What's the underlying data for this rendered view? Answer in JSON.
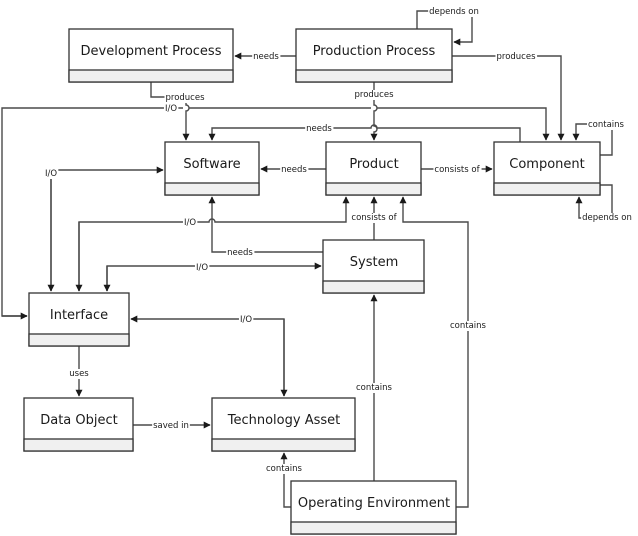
{
  "diagram": {
    "nodes": {
      "development_process": "Development Process",
      "production_process": "Production Process",
      "software": "Software",
      "product": "Product",
      "component": "Component",
      "system": "System",
      "interface": "Interface",
      "data_object": "Data Object",
      "technology_asset": "Technology Asset",
      "operating_environment": "Operating Environment"
    },
    "edges": {
      "prod_depends_on": "depends on",
      "prod_needs_dev": "needs",
      "prod_produces_component": "produces",
      "prod_produces_product": "produces",
      "dev_produces_software": "produces",
      "io_interface_component": "I/O",
      "component_needs_software": "needs",
      "component_contains": "contains",
      "product_needs_software": "needs",
      "product_consists_of_component": "consists of",
      "component_depends_on": "depends on",
      "io_interface_software": "I/O",
      "io_interface_product": "I/O",
      "system_needs_software": "needs",
      "system_consists_of_product": "consists of",
      "io_interface_system": "I/O",
      "io_interface_tech": "I/O",
      "env_contains_product": "contains",
      "env_contains_system": "contains",
      "interface_uses_data": "uses",
      "data_saved_in_tech": "saved in",
      "env_contains_tech": "contains"
    }
  }
}
